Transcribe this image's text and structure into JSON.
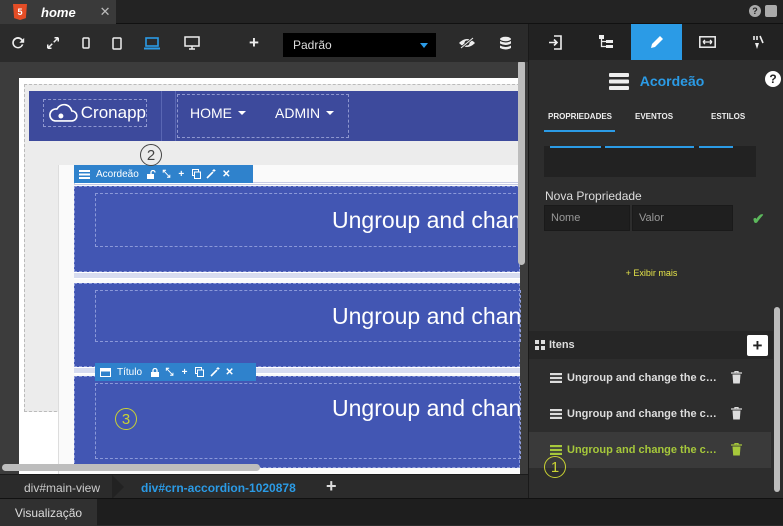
{
  "file_tab": {
    "icon_text": "5",
    "name": "home",
    "close": "✕"
  },
  "toolbar": {
    "layout_select": "Padrão"
  },
  "navbar": {
    "brand": "Cronapp",
    "menu": [
      {
        "label": "HOME"
      },
      {
        "label": "ADMIN"
      }
    ]
  },
  "accordion": {
    "control_label": "Acordeão",
    "item_control_label": "Título",
    "panels": [
      {
        "title": "Ungroup and change the content"
      },
      {
        "title": "Ungroup and change the content"
      },
      {
        "title": "Ungroup and change the content"
      }
    ]
  },
  "callouts": {
    "one": "1",
    "two": "2",
    "three": "3"
  },
  "breadcrumb": {
    "items": [
      "div#main-view",
      "div#crn-accordion-1020878"
    ],
    "add": "+"
  },
  "status": {
    "tab": "Visualização"
  },
  "right_panel": {
    "title": "Acordeão",
    "help": "?",
    "subtabs": [
      "PROPRIEDADES",
      "EVENTOS",
      "ESTILOS"
    ],
    "new_property": {
      "label": "Nova Propriedade",
      "name_placeholder": "Nome",
      "value_placeholder": "Valor"
    },
    "show_more": "+ Exibir mais",
    "items": {
      "header": "Itens",
      "add": "+",
      "list": [
        {
          "label": "Ungroup and change the co..."
        },
        {
          "label": "Ungroup and change the co..."
        },
        {
          "label": "Ungroup and change the co..."
        }
      ]
    }
  },
  "colors": {
    "accent": "#2b9be6",
    "navbar": "#3d4a9c",
    "accordion": "#4256b3",
    "callout": "#c9d233",
    "selected_text": "#a6c83b"
  }
}
